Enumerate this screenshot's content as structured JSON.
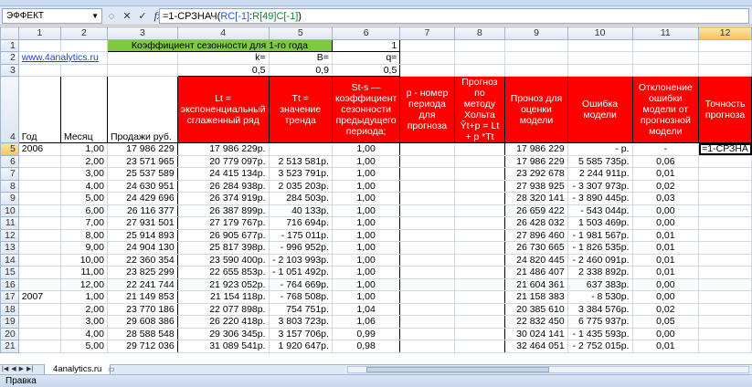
{
  "name_box": "ЭФФЕКТ",
  "formula": {
    "prefix": "=1-СРЗНАЧ(",
    "ref1": "RC[-1]",
    "sep": ":",
    "ref2": "R[49]C[-1]",
    "suffix": ")"
  },
  "col_headers": [
    "1",
    "2",
    "3",
    "4",
    "5",
    "6",
    "7",
    "8",
    "9",
    "10",
    "11",
    "12"
  ],
  "rows": {
    "r1": {
      "title": "Коэффициент сезонности для 1-го года",
      "value": "1"
    },
    "r2": {
      "site": "www.4analytics.ru",
      "k_label": "k=",
      "b_label": "B=",
      "q_label": "q="
    },
    "r3": {
      "k": "0,5",
      "b": "0,9",
      "q": "0,5"
    },
    "r4": {
      "c1": "Год",
      "c2": "Месяц",
      "c3": "Продажи руб.",
      "c4": "Lt = экспоненциальный сглаженный ряд",
      "c5": "Tt = значение тренда",
      "c6": "St-s — коэффициент сезонности предыдущего периода;",
      "c7": "p - номер периода для прогноза",
      "c8": "Прогноз по методу Хольта Ŷt+p = Lt + p *Tt",
      "c9": "Проноз для оценки модели",
      "c10": "Ошибка модели",
      "c11": "Отклонение ошибки модели от прогнозной модели",
      "c12": "Точность прогноза"
    }
  },
  "data_rows": [
    {
      "row": "5",
      "year": "2006",
      "m": "1,00",
      "s": "17 986 229",
      "l": "17 986 229р.",
      "t": "",
      "st": "1,00",
      "f": "17 986 229",
      "e": "-   р.",
      "d": "-",
      "acc": "=1-СРЗНА"
    },
    {
      "row": "6",
      "year": "",
      "m": "2,00",
      "s": "23 571 965",
      "l": "20 779 097р.",
      "t": "2 513 581р.",
      "st": "1,00",
      "f": "17 986 229",
      "e": "5 585 735р.",
      "d": "0,06",
      "acc": ""
    },
    {
      "row": "7",
      "year": "",
      "m": "3,00",
      "s": "25 537 589",
      "l": "24 415 134р.",
      "t": "3 523 791р.",
      "st": "1,00",
      "f": "23 292 678",
      "e": "2 244 911р.",
      "d": "0,01",
      "acc": ""
    },
    {
      "row": "8",
      "year": "",
      "m": "4,00",
      "s": "24 630 951",
      "l": "26 284 938р.",
      "t": "2 035 203р.",
      "st": "1,00",
      "f": "27 938 925",
      "e": "-  3 307 973р.",
      "d": "0,02",
      "acc": ""
    },
    {
      "row": "9",
      "year": "",
      "m": "5,00",
      "s": "24 429 696",
      "l": "26 374 919р.",
      "t": "284 503р.",
      "st": "1,00",
      "f": "28 320 141",
      "e": "-  3 890 445р.",
      "d": "0,03",
      "acc": ""
    },
    {
      "row": "10",
      "year": "",
      "m": "6,00",
      "s": "26 116 377",
      "l": "26 387 899р.",
      "t": "40 133р.",
      "st": "1,00",
      "f": "26 659 422",
      "e": "-    543 044р.",
      "d": "0,00",
      "acc": ""
    },
    {
      "row": "11",
      "year": "",
      "m": "7,00",
      "s": "27 931 501",
      "l": "27 179 767р.",
      "t": "716 694р.",
      "st": "1,00",
      "f": "26 428 032",
      "e": "1 503 469р.",
      "d": "0,00",
      "acc": ""
    },
    {
      "row": "12",
      "year": "",
      "m": "8,00",
      "s": "25 914 893",
      "l": "26 905 677р.",
      "t": "-      175 011р.",
      "st": "1,00",
      "f": "27 896 460",
      "e": "-  1 981 567р.",
      "d": "0,01",
      "acc": ""
    },
    {
      "row": "13",
      "year": "",
      "m": "9,00",
      "s": "24 904 130",
      "l": "25 817 398р.",
      "t": "-      996 952р.",
      "st": "1,00",
      "f": "26 730 665",
      "e": "-  1 826 535р.",
      "d": "0,01",
      "acc": ""
    },
    {
      "row": "14",
      "year": "",
      "m": "10,00",
      "s": "22 360 354",
      "l": "23 590 400р.",
      "t": "-   2 103 993р.",
      "st": "1,00",
      "f": "24 820 445",
      "e": "-  2 460 091р.",
      "d": "0,01",
      "acc": ""
    },
    {
      "row": "15",
      "year": "",
      "m": "11,00",
      "s": "23 825 299",
      "l": "22 655 853р.",
      "t": "-   1 051 492р.",
      "st": "1,00",
      "f": "21 486 407",
      "e": "2 338 892р.",
      "d": "0,01",
      "acc": ""
    },
    {
      "row": "16",
      "year": "",
      "m": "12,00",
      "s": "22 241 744",
      "l": "21 923 052р.",
      "t": "-      764 669р.",
      "st": "1,00",
      "f": "21 604 361",
      "e": "637 383р.",
      "d": "0,00",
      "acc": ""
    },
    {
      "row": "17",
      "year": "2007",
      "m": "1,00",
      "s": "21 149 853",
      "l": "21 154 118р.",
      "t": "-      768 508р.",
      "st": "1,00",
      "f": "21 158 383",
      "e": "-      8 530р.",
      "d": "0,00",
      "acc": ""
    },
    {
      "row": "18",
      "year": "",
      "m": "2,00",
      "s": "23 770 186",
      "l": "22 077 898р.",
      "t": "754 751р.",
      "st": "1,04",
      "f": "20 385 610",
      "e": "3 384 576р.",
      "d": "0,02",
      "acc": ""
    },
    {
      "row": "19",
      "year": "",
      "m": "3,00",
      "s": "29 608 386",
      "l": "26 220 418р.",
      "t": "3 803 723р.",
      "st": "1,06",
      "f": "22 832 450",
      "e": "6 775 937р.",
      "d": "0,05",
      "acc": ""
    },
    {
      "row": "20",
      "year": "",
      "m": "4,00",
      "s": "28 588 548",
      "l": "29 306 345р.",
      "t": "3 157 706р.",
      "st": "0,99",
      "f": "30 024 141",
      "e": "-  1 435 593р.",
      "d": "0,00",
      "acc": ""
    },
    {
      "row": "21",
      "year": "",
      "m": "5,00",
      "s": "29 712 036",
      "l": "31 089 541р.",
      "t": "1 920 647р.",
      "st": "0,98",
      "f": "32 464 051",
      "e": "-  2 752 015р.",
      "d": "0,01",
      "acc": ""
    }
  ],
  "sheet_tab": "4analytics.ru",
  "status": "Правка",
  "colors": {
    "red_header": "#ff0000",
    "green_title": "#7ec940",
    "link": "#1f3fd0"
  }
}
